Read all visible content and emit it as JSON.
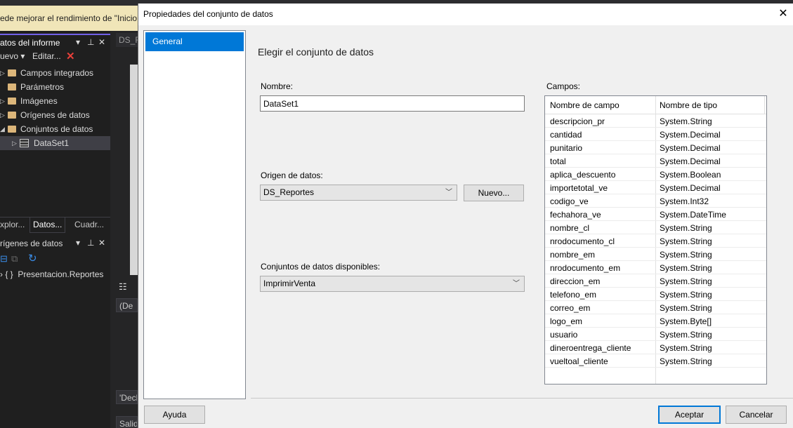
{
  "background": {
    "infobar_text": "ede mejorar el rendimiento de \"Inicio",
    "panel_title": "atos del informe",
    "toolbar_new": "uevo",
    "toolbar_edit": "Editar...",
    "tree": [
      {
        "label": "Campos integrados",
        "expander": "▷"
      },
      {
        "label": "Parámetros",
        "expander": ""
      },
      {
        "label": "Imágenes",
        "expander": "▷"
      },
      {
        "label": "Orígenes de datos",
        "expander": "▷"
      },
      {
        "label": "Conjuntos de datos",
        "expander": "◢"
      }
    ],
    "dataset_item": "DataSet1",
    "bottom_tabs": [
      "xplor...",
      "Datos...",
      "Cuadr..."
    ],
    "panel2_title": "rígenes de datos",
    "panel2_item": "Presentacion.Reportes",
    "doc_tab": "DS_R",
    "props_box": "(De",
    "decl_box": "'Decl",
    "salid_box": "Salid"
  },
  "dialog": {
    "title": "Propiedades del conjunto de datos",
    "close_glyph": "✕",
    "nav": {
      "selected": "General"
    },
    "heading": "Elegir el conjunto de datos",
    "name_label": "Nombre:",
    "name_value": "DataSet1",
    "source_label": "Origen de datos:",
    "source_value": "DS_Reportes",
    "new_button": "Nuevo...",
    "available_label": "Conjuntos de datos disponibles:",
    "available_value": "ImprimirVenta",
    "fields_label": "Campos:",
    "fields_columns": [
      "Nombre de campo",
      "Nombre de tipo"
    ],
    "fields": [
      [
        "descripcion_pr",
        "System.String"
      ],
      [
        "cantidad",
        "System.Decimal"
      ],
      [
        "punitario",
        "System.Decimal"
      ],
      [
        "total",
        "System.Decimal"
      ],
      [
        "aplica_descuento",
        "System.Boolean"
      ],
      [
        "importetotal_ve",
        "System.Decimal"
      ],
      [
        "codigo_ve",
        "System.Int32"
      ],
      [
        "fechahora_ve",
        "System.DateTime"
      ],
      [
        "nombre_cl",
        "System.String"
      ],
      [
        "nrodocumento_cl",
        "System.String"
      ],
      [
        "nombre_em",
        "System.String"
      ],
      [
        "nrodocumento_em",
        "System.String"
      ],
      [
        "direccion_em",
        "System.String"
      ],
      [
        "telefono_em",
        "System.String"
      ],
      [
        "correo_em",
        "System.String"
      ],
      [
        "logo_em",
        "System.Byte[]"
      ],
      [
        "usuario",
        "System.String"
      ],
      [
        "dineroentrega_cliente",
        "System.String"
      ],
      [
        "vueltoal_cliente",
        "System.String"
      ]
    ],
    "help_button": "Ayuda",
    "ok_button": "Aceptar",
    "cancel_button": "Cancelar"
  }
}
